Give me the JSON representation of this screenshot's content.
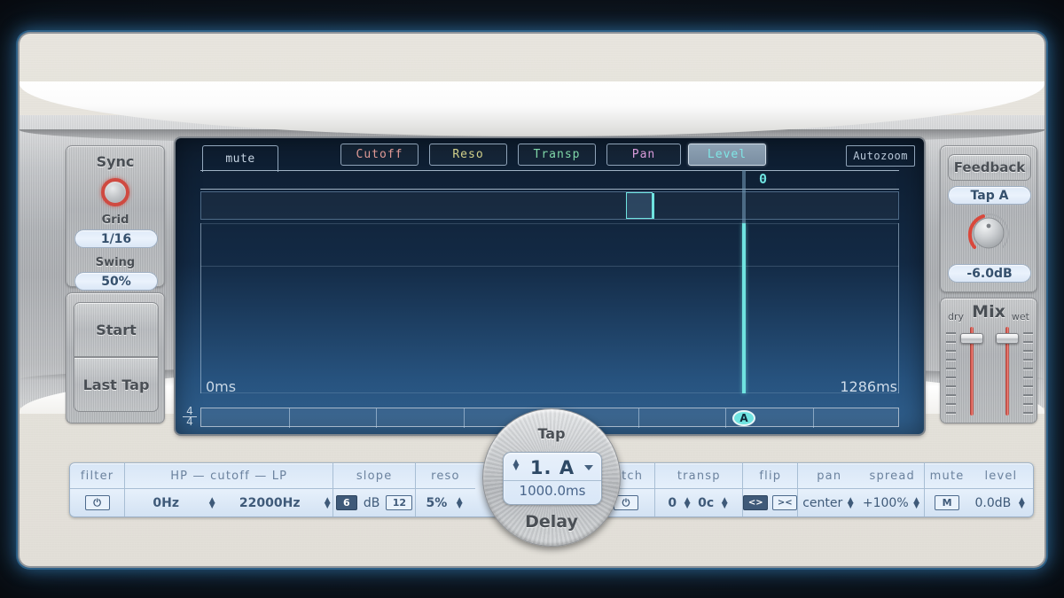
{
  "sync": {
    "title": "Sync",
    "led": "sync-led",
    "grid_label": "Grid",
    "grid_value": "1/16",
    "swing_label": "Swing",
    "swing_value": "50%"
  },
  "transport": {
    "start": "Start",
    "last_tap": "Last Tap"
  },
  "display": {
    "mute_tab": "mute",
    "param_tabs": [
      {
        "label": "Cutoff",
        "color": "#e09a96",
        "selected": false
      },
      {
        "label": "Reso",
        "color": "#d2d08a",
        "selected": false
      },
      {
        "label": "Transp",
        "color": "#7fd6a8",
        "selected": false
      },
      {
        "label": "Pan",
        "color": "#d79ad9",
        "selected": false
      },
      {
        "label": "Level",
        "color": "#7fe6e6",
        "selected": true
      }
    ],
    "autozoom": "Autozoom",
    "tap_index": "0",
    "time_start": "0ms",
    "time_end": "1286ms",
    "time_signature_top": "4",
    "time_signature_bottom": "4",
    "tap_marker": "A",
    "tap_color": "#6fe3e0"
  },
  "feedback": {
    "title": "Feedback",
    "tap_source": "Tap A",
    "value": "-6.0dB",
    "knob_color": "#d9483c"
  },
  "mix": {
    "title": "Mix",
    "dry_label": "dry",
    "wet_label": "wet",
    "dry_value": 92,
    "wet_value": 92,
    "slider_color": "#e05a50"
  },
  "controls": {
    "filter": {
      "label": "filter",
      "power": "⏻",
      "power_on": false,
      "range_label": "HP — cutoff — LP",
      "hp_value": "0Hz",
      "lp_value": "22000Hz"
    },
    "slope": {
      "label": "slope",
      "opt_6": "6",
      "opt_12": "12",
      "unit": "dB",
      "selected": "6"
    },
    "reso": {
      "label": "reso",
      "value": "5%"
    },
    "pitch": {
      "label": "pitch",
      "power": "⏻",
      "power_on": false,
      "value": "0"
    },
    "transp": {
      "label": "transp",
      "value": "0c"
    },
    "flip": {
      "label": "flip",
      "out_icon": "<>",
      "in_icon": "><",
      "selected": "out"
    },
    "pan": {
      "label": "pan",
      "value": "center"
    },
    "spread": {
      "label": "spread",
      "value": "+100%"
    },
    "mute": {
      "label": "mute",
      "button": "M",
      "active": false
    },
    "level": {
      "label": "level",
      "value": "0.0dB"
    }
  },
  "dial": {
    "top_label": "Tap",
    "bottom_label": "Delay",
    "tap_name": "1. A",
    "delay_ms": "1000.0ms"
  }
}
